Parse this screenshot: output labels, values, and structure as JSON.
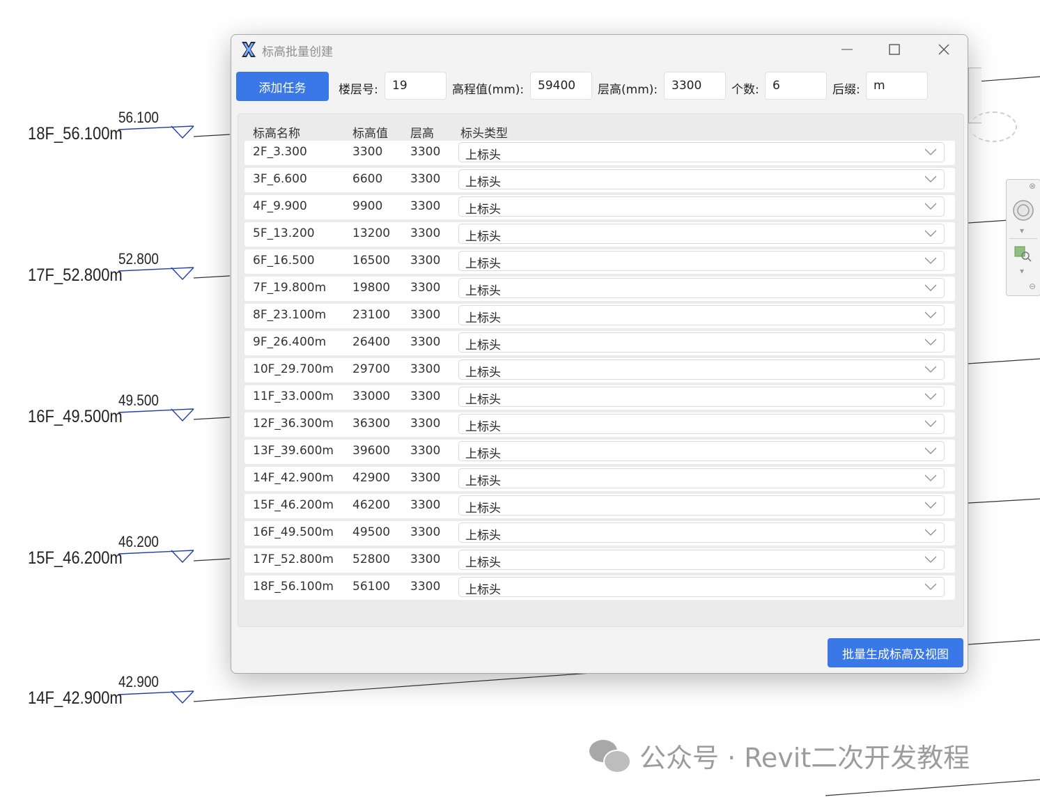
{
  "background": {
    "levels": [
      {
        "name": "18F_56.100m",
        "elevation": "56.100"
      },
      {
        "name": "17F_52.800m",
        "elevation": "52.800"
      },
      {
        "name": "16F_49.500m",
        "elevation": "49.500"
      },
      {
        "name": "15F_46.200m",
        "elevation": "46.200"
      },
      {
        "name": "14F_42.900m",
        "elevation": "42.900"
      }
    ],
    "watermark": "公众号 · Revit二次开发教程"
  },
  "dialog": {
    "title": "标高批量创建",
    "toolbar": {
      "add_task_label": "添加任务",
      "floor_label": "楼层号:",
      "floor_value": "19",
      "elev_label": "高程值(mm):",
      "elev_value": "59400",
      "height_label": "层高(mm):",
      "height_value": "3300",
      "count_label": "个数:",
      "count_value": "6",
      "suffix_label": "后缀:",
      "suffix_value": "m"
    },
    "table": {
      "headers": [
        "标高名称",
        "标高值",
        "层高",
        "标头类型"
      ],
      "rows": [
        {
          "name": "2F_3.300",
          "elevation": "3300",
          "height": "3300",
          "head_type": "上标头"
        },
        {
          "name": "3F_6.600",
          "elevation": "6600",
          "height": "3300",
          "head_type": "上标头"
        },
        {
          "name": "4F_9.900",
          "elevation": "9900",
          "height": "3300",
          "head_type": "上标头"
        },
        {
          "name": "5F_13.200",
          "elevation": "13200",
          "height": "3300",
          "head_type": "上标头"
        },
        {
          "name": "6F_16.500",
          "elevation": "16500",
          "height": "3300",
          "head_type": "上标头"
        },
        {
          "name": "7F_19.800m",
          "elevation": "19800",
          "height": "3300",
          "head_type": "上标头"
        },
        {
          "name": "8F_23.100m",
          "elevation": "23100",
          "height": "3300",
          "head_type": "上标头"
        },
        {
          "name": "9F_26.400m",
          "elevation": "26400",
          "height": "3300",
          "head_type": "上标头"
        },
        {
          "name": "10F_29.700m",
          "elevation": "29700",
          "height": "3300",
          "head_type": "上标头"
        },
        {
          "name": "11F_33.000m",
          "elevation": "33000",
          "height": "3300",
          "head_type": "上标头"
        },
        {
          "name": "12F_36.300m",
          "elevation": "36300",
          "height": "3300",
          "head_type": "上标头"
        },
        {
          "name": "13F_39.600m",
          "elevation": "39600",
          "height": "3300",
          "head_type": "上标头"
        },
        {
          "name": "14F_42.900m",
          "elevation": "42900",
          "height": "3300",
          "head_type": "上标头"
        },
        {
          "name": "15F_46.200m",
          "elevation": "46200",
          "height": "3300",
          "head_type": "上标头"
        },
        {
          "name": "16F_49.500m",
          "elevation": "49500",
          "height": "3300",
          "head_type": "上标头"
        },
        {
          "name": "17F_52.800m",
          "elevation": "52800",
          "height": "3300",
          "head_type": "上标头"
        },
        {
          "name": "18F_56.100m",
          "elevation": "56100",
          "height": "3300",
          "head_type": "上标头"
        }
      ]
    },
    "generate_label": "批量生成标高及视图"
  },
  "colors": {
    "primary": "#3b78e7",
    "level_marker": "#1f3fa8"
  }
}
